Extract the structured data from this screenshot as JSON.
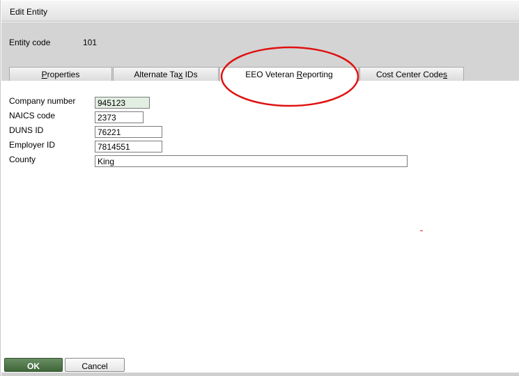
{
  "window": {
    "title": "Edit Entity"
  },
  "entity": {
    "code_label": "Entity code",
    "code_value": "101"
  },
  "tabs": [
    {
      "label_pre": "",
      "accel": "P",
      "label_post": "roperties"
    },
    {
      "label_pre": "Alternate Ta",
      "accel": "x",
      "label_post": " IDs"
    },
    {
      "label_pre": "EEO Veteran ",
      "accel": "R",
      "label_post": "eporting",
      "active": true
    },
    {
      "label_pre": "Cost Center Code",
      "accel": "s",
      "label_post": ""
    }
  ],
  "form": {
    "company_number": {
      "label": "Company number",
      "value": "945123"
    },
    "naics_code": {
      "label": "NAICS code",
      "value": "2373"
    },
    "duns_id": {
      "label": "DUNS ID",
      "value": "76221"
    },
    "employer_id": {
      "label": "Employer ID",
      "value": "7814551"
    },
    "county": {
      "label": "County",
      "value": "King"
    }
  },
  "buttons": {
    "ok": "OK",
    "cancel": "Cancel"
  },
  "colors": {
    "annotation": "#e01010",
    "ok_button": "#4a7344"
  }
}
